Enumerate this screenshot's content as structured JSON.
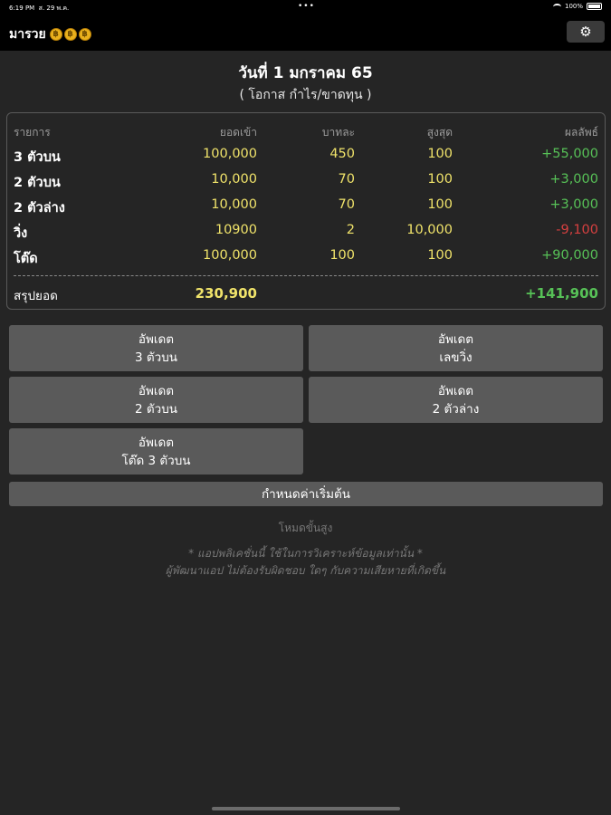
{
  "status_bar": {
    "time": "6:19 PM",
    "date": "ส. 29 พ.ค.",
    "battery": "100%"
  },
  "navbar": {
    "app_name": "มารวย",
    "coins": [
      "฿",
      "฿",
      "฿"
    ],
    "settings_icon": "gear-icon"
  },
  "header": {
    "title": "วันที่ 1 มกราคม 65",
    "subtitle": "( โอกาส กำไร/ขาดทุน )"
  },
  "table": {
    "columns": [
      "รายการ",
      "ยอดเข้า",
      "บาทละ",
      "สูงสุด",
      "ผลลัพธ์"
    ],
    "rows": [
      {
        "label": "3 ตัวบน",
        "income": "100,000",
        "rate": "450",
        "max": "100",
        "result": "+55,000",
        "result_sign": "pos"
      },
      {
        "label": "2 ตัวบน",
        "income": "10,000",
        "rate": "70",
        "max": "100",
        "result": "+3,000",
        "result_sign": "pos"
      },
      {
        "label": "2 ตัวล่าง",
        "income": "10,000",
        "rate": "70",
        "max": "100",
        "result": "+3,000",
        "result_sign": "pos"
      },
      {
        "label": "วิ่ง",
        "income": "10900",
        "rate": "2",
        "max": "10,000",
        "result": "-9,100",
        "result_sign": "neg"
      },
      {
        "label": "โต๊ด",
        "income": "100,000",
        "rate": "100",
        "max": "100",
        "result": "+90,000",
        "result_sign": "pos"
      }
    ],
    "total": {
      "label": "สรุปยอด",
      "income": "230,900",
      "result": "+141,900"
    }
  },
  "buttons": {
    "update_3_top": {
      "line1": "อัพเดต",
      "line2": "3 ตัวบน"
    },
    "update_run": {
      "line1": "อัพเดต",
      "line2": "เลขวิ่ง"
    },
    "update_2_top": {
      "line1": "อัพเดต",
      "line2": "2 ตัวบน"
    },
    "update_2_bottom": {
      "line1": "อัพเดต",
      "line2": "2 ตัวล่าง"
    },
    "update_tod": {
      "line1": "อัพเดต",
      "line2": "โต๊ด 3 ตัวบน"
    },
    "set_initial": "กำหนดค่าเริ่มต้น"
  },
  "footer": {
    "advanced_mode": "โหมดขั้นสูง",
    "disclaimer1": "* แอปพลิเคชั่นนี้ ใช้ในการวิเคราะห์ข้อมูลเท่านั้น *",
    "disclaimer2": "ผู้พัฒนาแอป ไม่ต้องรับผิดชอบ ใดๆ กับความเสียหายที่เกิดขึ้น"
  },
  "colors": {
    "background": "#252525",
    "bar": "#000000",
    "yellow": "#f0e36a",
    "green": "#57c157",
    "red": "#d64040",
    "button": "#5a5a5a"
  }
}
